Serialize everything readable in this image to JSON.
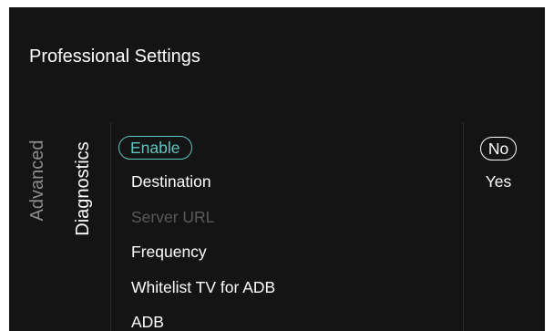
{
  "header": {
    "title": "Professional Settings"
  },
  "tabs": [
    {
      "label": "Advanced",
      "active": false
    },
    {
      "label": "Diagnostics",
      "active": true
    }
  ],
  "menu": {
    "items": [
      {
        "label": "Enable",
        "state": "selected"
      },
      {
        "label": "Destination",
        "state": "normal"
      },
      {
        "label": "Server URL",
        "state": "disabled"
      },
      {
        "label": "Frequency",
        "state": "normal"
      },
      {
        "label": "Whitelist TV for ADB",
        "state": "normal"
      },
      {
        "label": "ADB",
        "state": "normal"
      }
    ]
  },
  "options": {
    "items": [
      {
        "label": "No",
        "current": true
      },
      {
        "label": "Yes",
        "current": false
      }
    ]
  },
  "colors": {
    "background": "#141414",
    "accent": "#5fc6c2",
    "text": "#ffffff",
    "inactive_tab": "#8c8c8c",
    "disabled": "#5a5a5a"
  }
}
